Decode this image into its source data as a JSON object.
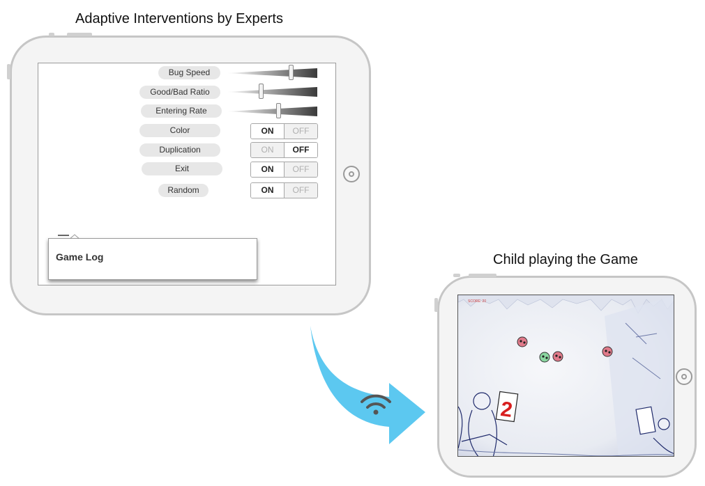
{
  "captions": {
    "left": "Adaptive Interventions by Experts",
    "right": "Child playing the Game"
  },
  "controls": {
    "sliders": [
      {
        "label": "Bug Speed",
        "level": 0.72
      },
      {
        "label": "Good/Bad Ratio",
        "level": 0.37
      },
      {
        "label": "Entering Rate",
        "level": 0.58
      }
    ],
    "toggles": [
      {
        "label": "Color",
        "on": "ON",
        "off": "OFF",
        "selected": "ON"
      },
      {
        "label": "Duplication",
        "on": "ON",
        "off": "OFF",
        "selected": "OFF"
      },
      {
        "label": "Exit",
        "on": "ON",
        "off": "OFF",
        "selected": "ON"
      },
      {
        "label": "Random",
        "on": "ON",
        "off": "OFF",
        "selected": "ON"
      }
    ]
  },
  "game_log": {
    "title": "Game Log"
  },
  "game": {
    "score_label": "SCORE: 20",
    "sign_number": "2"
  },
  "colors": {
    "arrow": "#5cc8f0",
    "device_frame": "#c6c6c6",
    "sign_number": "#d81e1e"
  },
  "icons": {
    "connection": "wifi-icon",
    "home": "home-button-icon"
  }
}
